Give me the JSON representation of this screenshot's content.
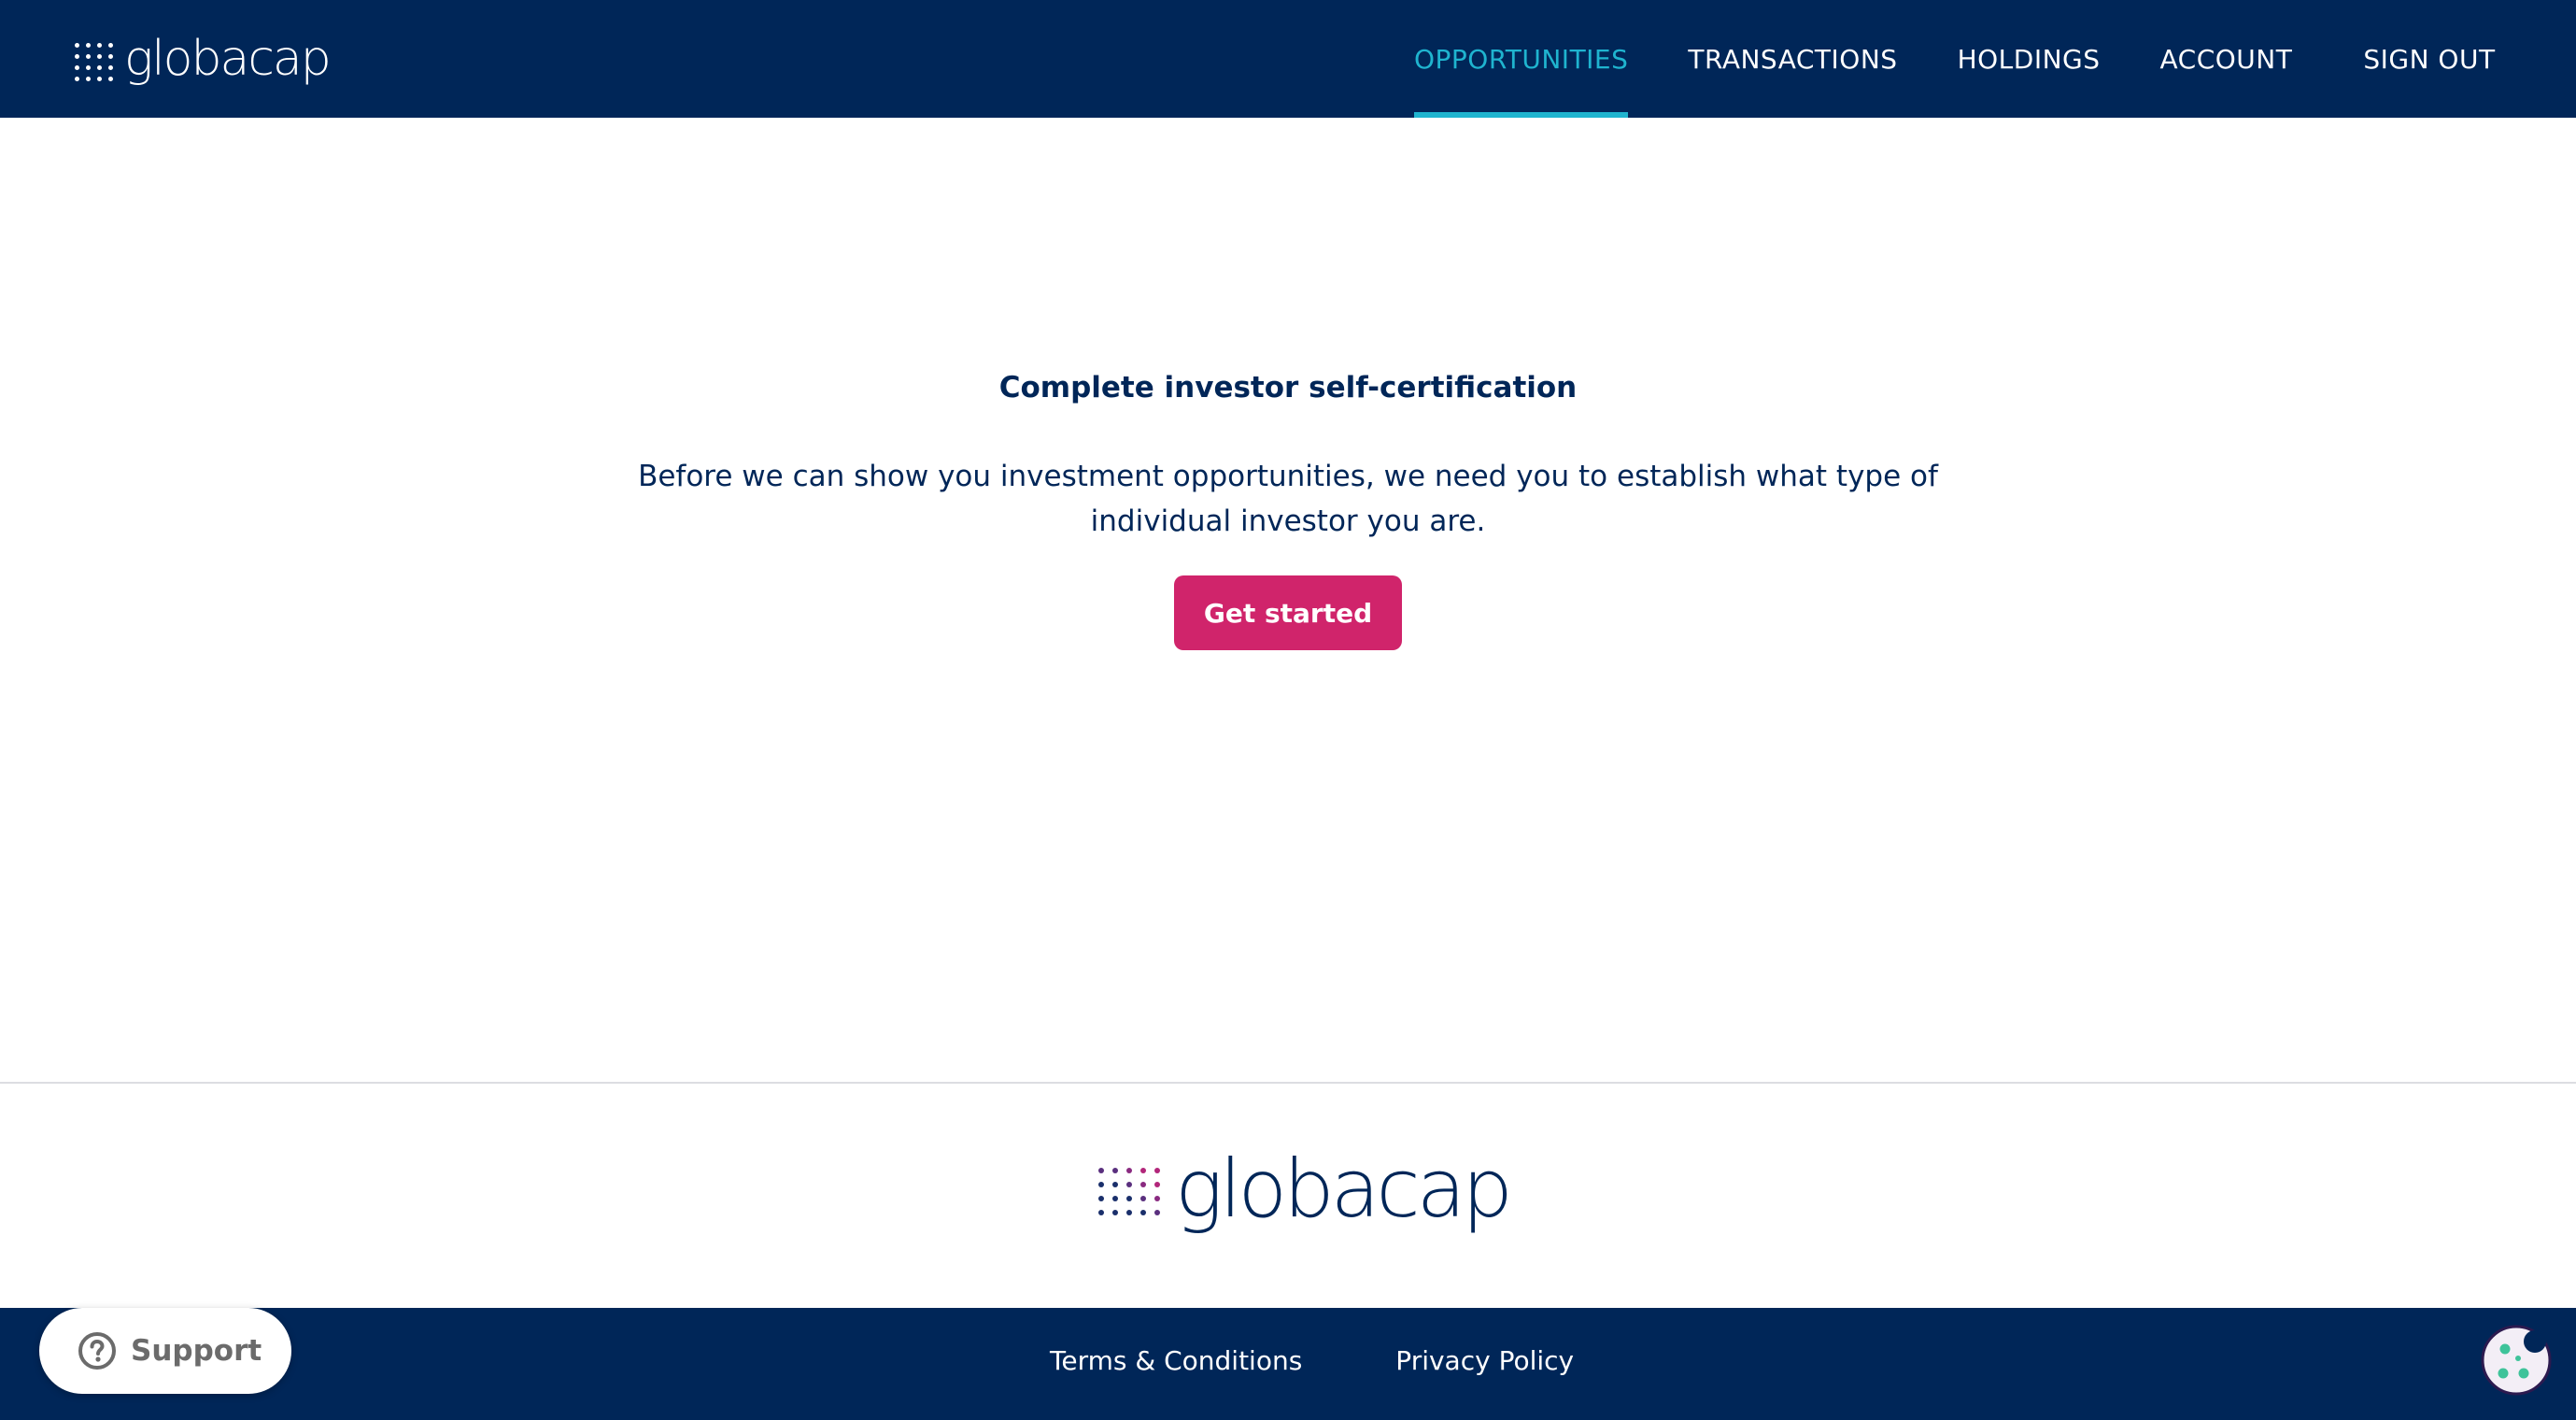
{
  "header": {
    "brand": "globacap",
    "nav": [
      {
        "label": "OPPORTUNITIES",
        "active": true
      },
      {
        "label": "TRANSACTIONS",
        "active": false
      },
      {
        "label": "HOLDINGS",
        "active": false
      },
      {
        "label": "ACCOUNT",
        "active": false
      },
      {
        "label": "SIGN OUT",
        "active": false
      }
    ]
  },
  "main": {
    "title": "Complete investor self-certification",
    "body": "Before we can show you investment opportunities, we need you to establish what type of individual investor you are.",
    "cta_label": "Get started"
  },
  "footer": {
    "brand": "globacap",
    "links": [
      "Terms & Conditions",
      "Privacy Policy"
    ]
  },
  "support": {
    "label": "Support",
    "icon": "question-circle-icon"
  },
  "cookie": {
    "icon": "cookie-icon"
  },
  "colors": {
    "navy": "#002658",
    "accent_cyan": "#1fb4cf",
    "cta_pink": "#d0246b"
  }
}
